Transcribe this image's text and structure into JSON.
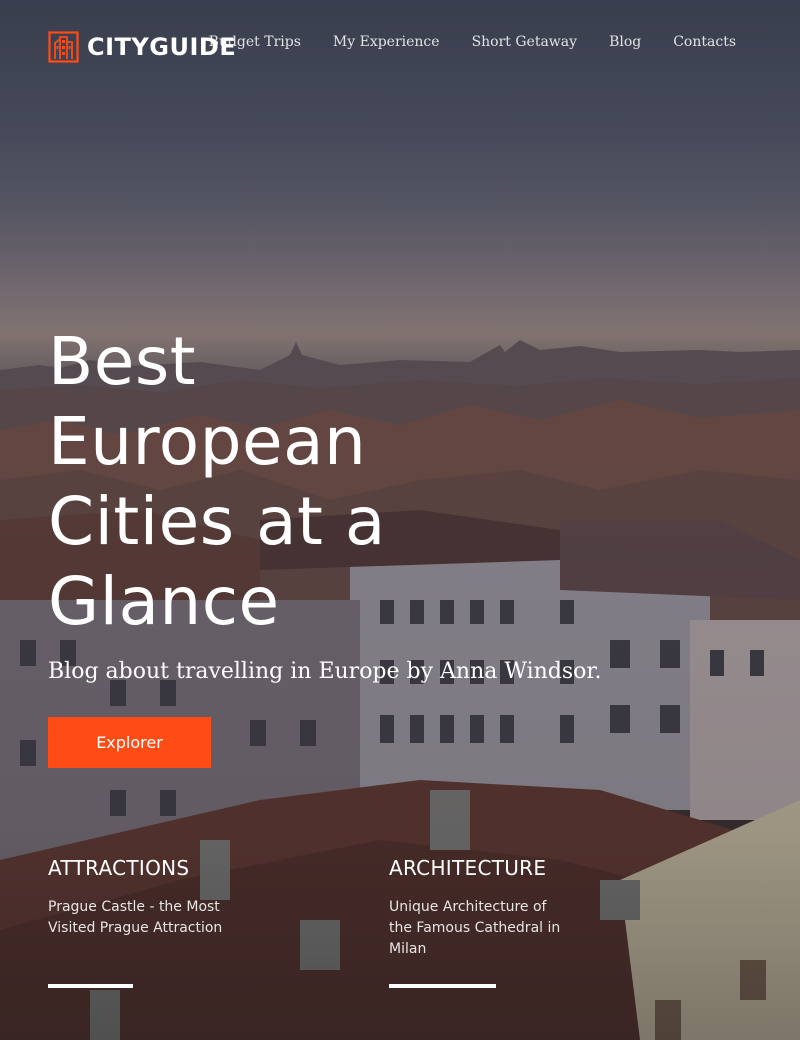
{
  "brand": {
    "name": "CITYGUIDE",
    "accent_color": "#ff4b14",
    "logo_icon": "building-icon"
  },
  "nav": {
    "items": [
      {
        "label": "Budget Trips"
      },
      {
        "label": "My Experience"
      },
      {
        "label": "Short Getaway"
      },
      {
        "label": "Blog"
      },
      {
        "label": "Contacts"
      }
    ]
  },
  "hero": {
    "title": "Best European Cities at a Glance",
    "subtitle": "Blog about travelling in Europe by Anna Windsor.",
    "cta_label": "Explorer"
  },
  "cards": [
    {
      "title": "ATTRACTIONS",
      "text": "Prague Castle - the Most Visited Prague Attraction"
    },
    {
      "title": "ARCHITECTURE",
      "text": "Unique Architecture of the Famous Cathedral in Milan"
    }
  ]
}
